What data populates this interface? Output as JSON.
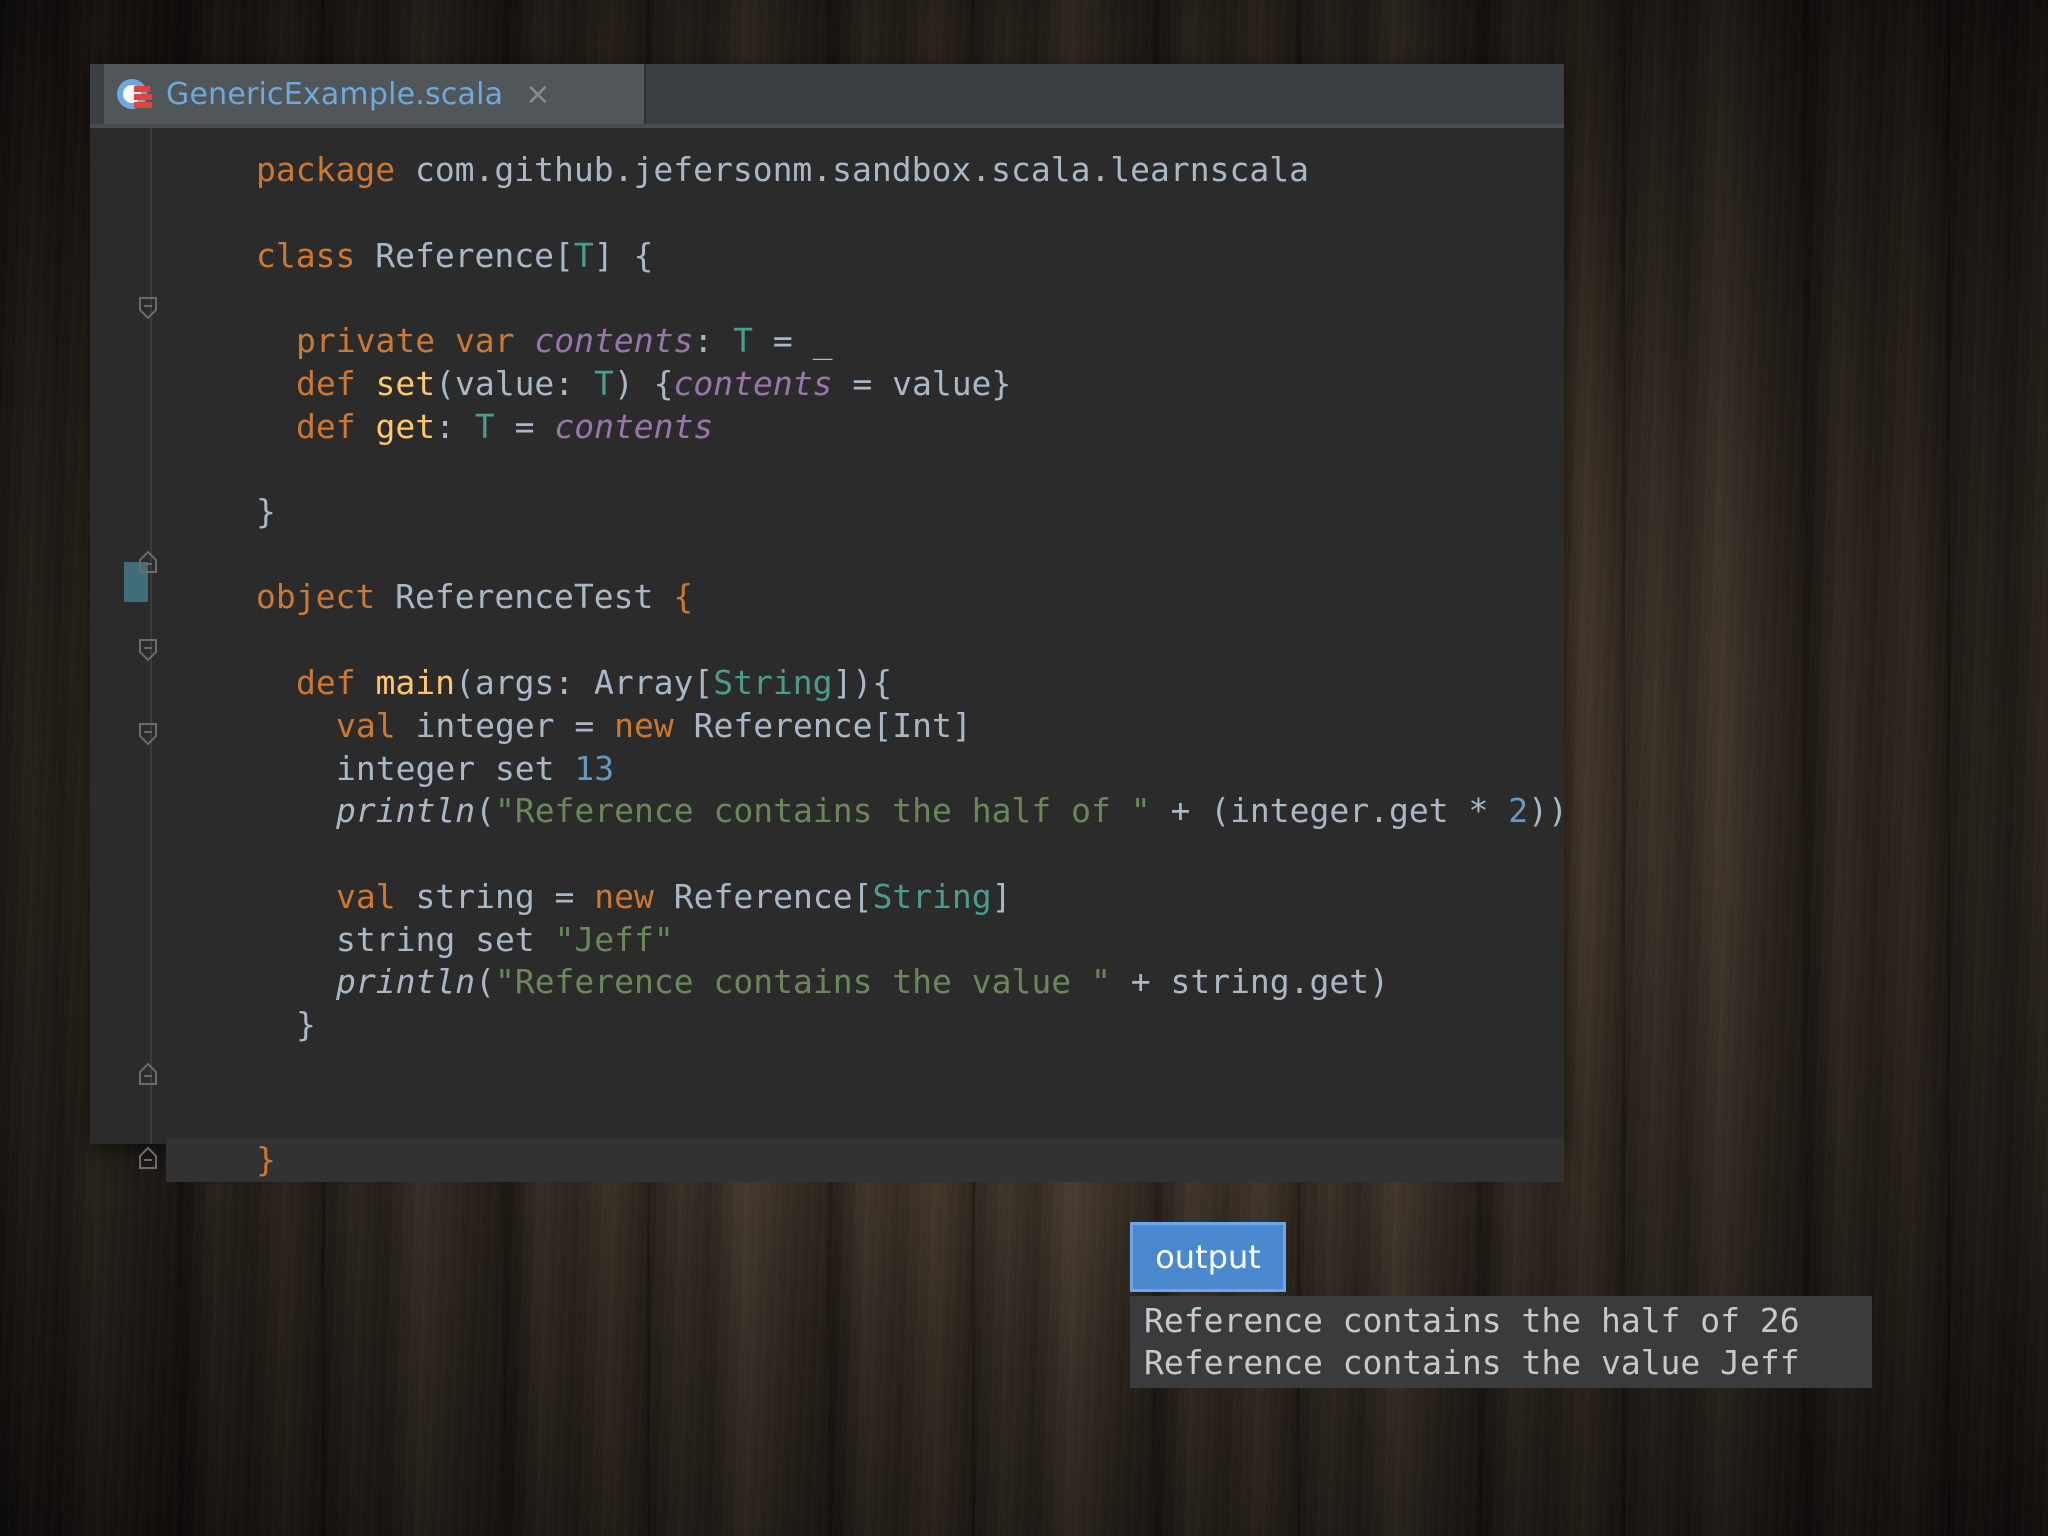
{
  "editor": {
    "tab": {
      "title": "GenericExample.scala",
      "close": "×",
      "icon": "scala-file-icon"
    },
    "code": {
      "line1": {
        "kw": "package",
        "rest": " com.github.jefersonm.sandbox.scala.learnscala"
      },
      "line2": {
        "kw": "class",
        "name": " Reference[",
        "tparam": "T",
        "rest": "] {"
      },
      "line3": {
        "kw": "private var ",
        "field": "contents",
        "colon": ": ",
        "type": "T",
        "rest": " = _"
      },
      "line4": {
        "kw": "def ",
        "fn": "set",
        "a": "(value: ",
        "type": "T",
        "b": ") {",
        "field": "contents",
        "c": " = value}"
      },
      "line5": {
        "kw": "def ",
        "fn": "get",
        "a": ": ",
        "type": "T",
        "b": " = ",
        "field": "contents"
      },
      "line6": "}",
      "line7": {
        "kw": "object",
        "name": " ReferenceTest ",
        "brace": "{"
      },
      "line8": {
        "kw": "def ",
        "fn": "main",
        "a": "(args: Array[",
        "type": "String",
        "b": "]){"
      },
      "line9": {
        "kw": "val",
        "a": " integer = ",
        "kw2": "new",
        "b": " Reference[Int]"
      },
      "line10": {
        "a": "integer set ",
        "num": "13"
      },
      "line11": {
        "fn": "println",
        "a": "(",
        "str": "\"Reference contains the half of \"",
        "b": " + (integer.get * ",
        "num": "2",
        "c": "))"
      },
      "line12": {
        "kw": "val",
        "a": " string = ",
        "kw2": "new",
        "b": " Reference[",
        "type": "String",
        "c": "]"
      },
      "line13": {
        "a": "string set ",
        "str": "\"Jeff\""
      },
      "line14": {
        "fn": "println",
        "a": "(",
        "str": "\"Reference contains the value \"",
        "b": " + string.get)"
      },
      "line15": "}",
      "line16": "}"
    }
  },
  "output": {
    "label": "output",
    "lines": [
      "Reference contains the half of 26",
      "Reference contains the value Jeff"
    ]
  },
  "colors": {
    "keyword": "#cc7832",
    "function": "#ffc66d",
    "type_param": "#4a9c8c",
    "field": "#9876aa",
    "number": "#6897bb",
    "string": "#6a8759",
    "default_text": "#a9b7c6",
    "editor_bg": "#2b2b2b",
    "output_label_bg": "#4a88d0"
  }
}
